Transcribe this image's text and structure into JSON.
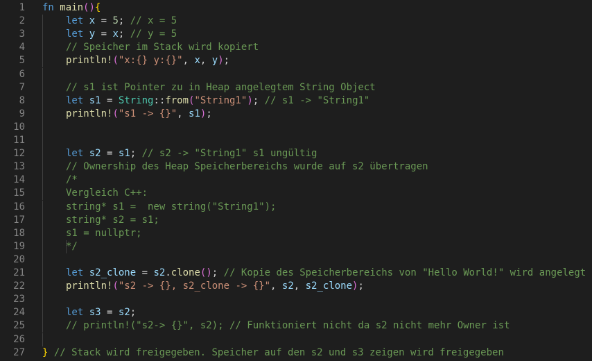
{
  "editor": {
    "lines": [
      {
        "n": "1",
        "indent": 0,
        "tokens": [
          [
            "k",
            "fn"
          ],
          [
            "p",
            " "
          ],
          [
            "f",
            "main"
          ],
          [
            "b2",
            "()"
          ],
          [
            "b",
            "{"
          ]
        ]
      },
      {
        "n": "2",
        "indent": 1,
        "tokens": [
          [
            "k",
            "let"
          ],
          [
            "p",
            " "
          ],
          [
            "v",
            "x"
          ],
          [
            "p",
            " = "
          ],
          [
            "n",
            "5"
          ],
          [
            "p",
            "; "
          ],
          [
            "c",
            "// x = 5"
          ]
        ]
      },
      {
        "n": "3",
        "indent": 1,
        "tokens": [
          [
            "k",
            "let"
          ],
          [
            "p",
            " "
          ],
          [
            "v",
            "y"
          ],
          [
            "p",
            " = "
          ],
          [
            "v",
            "x"
          ],
          [
            "p",
            "; "
          ],
          [
            "c",
            "// y = 5"
          ]
        ]
      },
      {
        "n": "4",
        "indent": 1,
        "tokens": [
          [
            "c",
            "// Speicher im Stack wird kopiert"
          ]
        ]
      },
      {
        "n": "5",
        "indent": 1,
        "tokens": [
          [
            "f",
            "println!"
          ],
          [
            "b2",
            "("
          ],
          [
            "s",
            "\"x:{} y:{}\""
          ],
          [
            "p",
            ", "
          ],
          [
            "v",
            "x"
          ],
          [
            "p",
            ", "
          ],
          [
            "v",
            "y"
          ],
          [
            "b2",
            ")"
          ],
          [
            "p",
            ";"
          ]
        ]
      },
      {
        "n": "6",
        "indent": 1,
        "tokens": []
      },
      {
        "n": "7",
        "indent": 1,
        "tokens": [
          [
            "c",
            "// s1 ist Pointer zu in Heap angelegtem String Object"
          ]
        ]
      },
      {
        "n": "8",
        "indent": 1,
        "tokens": [
          [
            "k",
            "let"
          ],
          [
            "p",
            " "
          ],
          [
            "v",
            "s1"
          ],
          [
            "p",
            " = "
          ],
          [
            "t",
            "String"
          ],
          [
            "p",
            "::"
          ],
          [
            "f",
            "from"
          ],
          [
            "b2",
            "("
          ],
          [
            "s",
            "\"String1\""
          ],
          [
            "b2",
            ")"
          ],
          [
            "p",
            "; "
          ],
          [
            "c",
            "// s1 -> \"String1\""
          ]
        ]
      },
      {
        "n": "9",
        "indent": 1,
        "tokens": [
          [
            "f",
            "println!"
          ],
          [
            "b2",
            "("
          ],
          [
            "s",
            "\"s1 -> {}\""
          ],
          [
            "p",
            ", "
          ],
          [
            "v",
            "s1"
          ],
          [
            "b2",
            ")"
          ],
          [
            "p",
            ";"
          ]
        ]
      },
      {
        "n": "10",
        "indent": 1,
        "tokens": []
      },
      {
        "n": "11",
        "indent": 1,
        "tokens": []
      },
      {
        "n": "12",
        "indent": 1,
        "tokens": [
          [
            "k",
            "let"
          ],
          [
            "p",
            " "
          ],
          [
            "v",
            "s2"
          ],
          [
            "p",
            " = "
          ],
          [
            "v",
            "s1"
          ],
          [
            "p",
            "; "
          ],
          [
            "c",
            "// s2 -> \"String1\" s1 ungültig"
          ]
        ]
      },
      {
        "n": "13",
        "indent": 1,
        "tokens": [
          [
            "c",
            "// Ownership des Heap Speicherbereichs wurde auf s2 übertragen"
          ]
        ]
      },
      {
        "n": "14",
        "indent": 1,
        "tokens": [
          [
            "c",
            "/*"
          ]
        ]
      },
      {
        "n": "15",
        "indent": 1,
        "tokens": [
          [
            "c",
            "Vergleich C++:"
          ]
        ]
      },
      {
        "n": "16",
        "indent": 1,
        "tokens": [
          [
            "c",
            "string* s1 =  new string(\"String1\");"
          ]
        ]
      },
      {
        "n": "17",
        "indent": 1,
        "tokens": [
          [
            "c",
            "string* s2 = s1;"
          ]
        ]
      },
      {
        "n": "18",
        "indent": 1,
        "tokens": [
          [
            "c",
            "s1 = nullptr;"
          ]
        ]
      },
      {
        "n": "19",
        "indent": 2,
        "tokens": [
          [
            "c",
            "*/"
          ]
        ]
      },
      {
        "n": "20",
        "indent": 1,
        "tokens": []
      },
      {
        "n": "21",
        "indent": 1,
        "tokens": [
          [
            "k",
            "let"
          ],
          [
            "p",
            " "
          ],
          [
            "v",
            "s2_clone"
          ],
          [
            "p",
            " = "
          ],
          [
            "v",
            "s2"
          ],
          [
            "p",
            "."
          ],
          [
            "f",
            "clone"
          ],
          [
            "b2",
            "()"
          ],
          [
            "p",
            "; "
          ],
          [
            "c",
            "// Kopie des Speicherbereichs von \"Hello World!\" wird angelegt"
          ]
        ]
      },
      {
        "n": "22",
        "indent": 1,
        "tokens": [
          [
            "f",
            "println!"
          ],
          [
            "b2",
            "("
          ],
          [
            "s",
            "\"s2 -> {}, s2_clone -> {}\""
          ],
          [
            "p",
            ", "
          ],
          [
            "v",
            "s2"
          ],
          [
            "p",
            ", "
          ],
          [
            "v",
            "s2_clone"
          ],
          [
            "b2",
            ")"
          ],
          [
            "p",
            ";"
          ]
        ]
      },
      {
        "n": "23",
        "indent": 1,
        "tokens": []
      },
      {
        "n": "24",
        "indent": 1,
        "tokens": [
          [
            "k",
            "let"
          ],
          [
            "p",
            " "
          ],
          [
            "v",
            "s3"
          ],
          [
            "p",
            " = "
          ],
          [
            "v",
            "s2"
          ],
          [
            "p",
            ";"
          ]
        ]
      },
      {
        "n": "25",
        "indent": 1,
        "tokens": [
          [
            "c",
            "// println!(\"s2-> {}\", s2); // Funktioniert nicht da s2 nicht mehr Owner ist"
          ]
        ]
      },
      {
        "n": "26",
        "indent": 1,
        "tokens": []
      },
      {
        "n": "27",
        "indent": 0,
        "tokens": [
          [
            "b",
            "}"
          ],
          [
            "p",
            " "
          ],
          [
            "c",
            "// Stack wird freigegeben. Speicher auf den s2 und s3 zeigen wird freigegeben"
          ]
        ]
      }
    ]
  }
}
